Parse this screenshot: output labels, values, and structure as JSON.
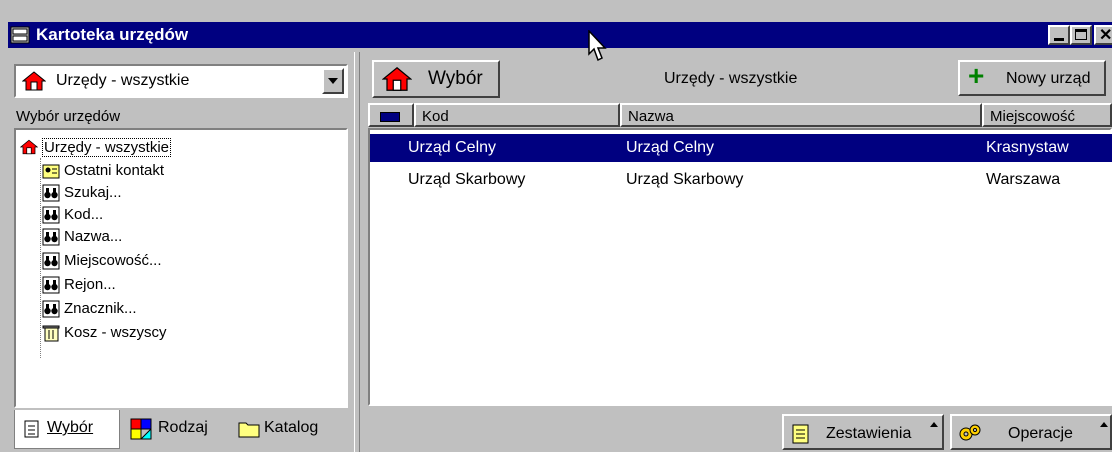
{
  "window": {
    "title": "Kartoteka urzędów"
  },
  "left": {
    "combo_value": "Urzędy - wszystkie",
    "section_label": "Wybór urzędów",
    "tree": [
      {
        "label": "Urzędy - wszystkie",
        "icon": "home-icon"
      },
      {
        "label": "Ostatni kontakt",
        "icon": "contact-card-icon"
      },
      {
        "label": "Szukaj...",
        "icon": "binoculars-icon"
      },
      {
        "label": "Kod...",
        "icon": "binoculars-icon"
      },
      {
        "label": "Nazwa...",
        "icon": "binoculars-icon"
      },
      {
        "label": "Miejscowość...",
        "icon": "binoculars-icon"
      },
      {
        "label": "Rejon...",
        "icon": "binoculars-icon"
      },
      {
        "label": "Znacznik...",
        "icon": "binoculars-icon"
      },
      {
        "label": "Kosz - wszyscy",
        "icon": "trash-icon"
      }
    ],
    "tabs": [
      {
        "label": "Wybór",
        "icon": "document-icon"
      },
      {
        "label": "Rodzaj",
        "icon": "shapes-icon"
      },
      {
        "label": "Katalog",
        "icon": "folder-icon"
      }
    ]
  },
  "right": {
    "select_button": "Wybór",
    "header_title": "Urzędy - wszystkie",
    "new_button": "Nowy urząd",
    "columns": [
      "Kod",
      "Nazwa",
      "Miejscowość"
    ],
    "rows": [
      {
        "kod": "Urząd Celny",
        "nazwa": "Urząd Celny",
        "miejscowosc": "Krasnystaw",
        "selected": true
      },
      {
        "kod": "Urząd Skarbowy",
        "nazwa": "Urząd Skarbowy",
        "miejscowosc": "Warszawa",
        "selected": false
      }
    ],
    "reports_button": "Zestawienia",
    "operations_button": "Operacje"
  },
  "colors": {
    "titlebar": "#000080",
    "selection": "#000080",
    "face": "#c0c0c0",
    "accent_plus": "#008000"
  }
}
